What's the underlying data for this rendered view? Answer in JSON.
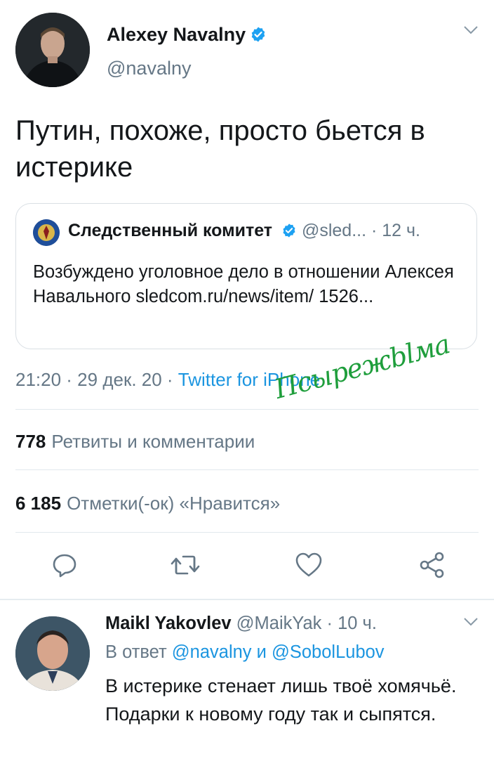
{
  "tweet": {
    "author_name": "Alexey Navalny",
    "author_handle": "@navalny",
    "verified_icon": "verified-badge-icon",
    "text": "Путин, похоже, просто бьется в истерике",
    "timestamp": "21:20 · 29 дек. 20 · ",
    "source": "Twitter for iPhone",
    "retweets_count": "778",
    "retweets_label": "Ретвиты и комментарии",
    "likes_count": "6 185",
    "likes_label": "Отметки(-ок) «Нравится»"
  },
  "quoted_tweet": {
    "author_name": "Следственный комитет",
    "meta": " @sled...  · 12 ч.",
    "text": "Возбуждено уголовное дело в отношении Алексея Навального sledcom.ru/news/item/ 1526..."
  },
  "watermark": "Псырежblма",
  "actions": [
    "reply-icon",
    "retweet-icon",
    "like-icon",
    "share-icon"
  ],
  "reply": {
    "author_name": "Maikl Yakovlev",
    "meta": " @MaikYak · 10 ч.",
    "replying_prefix": "В ответ ",
    "mention_1": "@navalny",
    "conjunction": " и ",
    "mention_2": "@SobolLubov",
    "text": "В истерике стенает  лишь твоё хомячьё. Подарки к новому году так и сыпятся."
  },
  "colors": {
    "link_blue": "#1b95e0",
    "secondary_text": "#657786",
    "watermark_green": "#1f9e3c"
  }
}
